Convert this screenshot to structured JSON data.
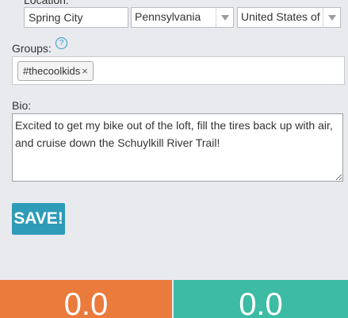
{
  "location": {
    "label": "Location:",
    "city_value": "Spring City",
    "state_value": "Pennsylvania",
    "country_value": "United States of America"
  },
  "groups": {
    "label": "Groups:",
    "help_glyph": "?",
    "tags": [
      {
        "text": "#thecoolkids",
        "remove_glyph": "×"
      }
    ]
  },
  "bio": {
    "label": "Bio:",
    "value": "Excited to get my bike out of the loft, fill the tires back up with air, and cruise down the Schuylkill River Trail!"
  },
  "save_label": "SAVE!",
  "stats": {
    "left_value": "0.0",
    "right_value": "0.0",
    "left_color": "#ea7b3c",
    "right_color": "#3dbba4"
  },
  "colors": {
    "accent": "#2e9bb8",
    "background": "#e9eaee"
  }
}
